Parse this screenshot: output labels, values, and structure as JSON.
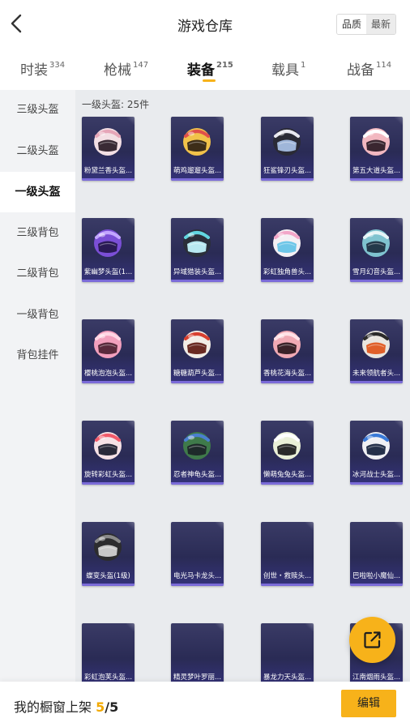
{
  "header": {
    "title": "游戏仓库",
    "sort_options": [
      "品质",
      "最新"
    ],
    "sort_active": "最新"
  },
  "tabs": [
    {
      "label": "时装",
      "count": "334"
    },
    {
      "label": "枪械",
      "count": "147"
    },
    {
      "label": "装备",
      "count": "215",
      "active": true
    },
    {
      "label": "载具",
      "count": "1"
    },
    {
      "label": "战备",
      "count": "114"
    }
  ],
  "sidebar": {
    "items": [
      "三级头盔",
      "二级头盔",
      "一级头盔",
      "三级背包",
      "二级背包",
      "一级背包",
      "背包挂件"
    ],
    "active": "一级头盔"
  },
  "content": {
    "count_label": "一级头盔: 25件",
    "items": [
      {
        "name": "粉黛兰香头盔...",
        "shell": "#f3dfe4",
        "accent": "#e6a6b8",
        "visor": "#3a2a35"
      },
      {
        "name": "萌鸡遛遛头盔...",
        "shell": "#f1c24a",
        "accent": "#e0504a",
        "visor": "#3d2d18"
      },
      {
        "name": "狂鲨锋刃头盔...",
        "shell": "#2a2a35",
        "accent": "#e8e8f0",
        "visor": "#9fb6d9"
      },
      {
        "name": "第五大道头盔...",
        "shell": "#f2b8c0",
        "accent": "#ffffff",
        "visor": "#3a2630"
      },
      {
        "name": "紫幽梦头盔(1...",
        "shell": "#7b4fd6",
        "accent": "#c3a6ff",
        "visor": "#2a1a55"
      },
      {
        "name": "异域猎装头盔...",
        "shell": "#2b2f3a",
        "accent": "#62d6e0",
        "visor": "#b8e8f0"
      },
      {
        "name": "彩虹独角兽头...",
        "shell": "#f4f0f4",
        "accent": "#f2a6c8",
        "visor": "#6ec6e8"
      },
      {
        "name": "雪月幻音头盔...",
        "shell": "#7fc3cf",
        "accent": "#e6f4f6",
        "visor": "#24394a"
      },
      {
        "name": "樱桃泡泡头盔...",
        "shell": "#f2a0bd",
        "accent": "#ffd6e4",
        "visor": "#5a2a3c"
      },
      {
        "name": "糖糖葫芦头盔...",
        "shell": "#f2ede6",
        "accent": "#d8402f",
        "visor": "#6a2a22"
      },
      {
        "name": "香桃花海头盔...",
        "shell": "#f0aab4",
        "accent": "#ffe2e6",
        "visor": "#3a2228"
      },
      {
        "name": "未来领航者头...",
        "shell": "#e9e6e0",
        "accent": "#2a2a2a",
        "visor": "#e0602a"
      },
      {
        "name": "旋转彩虹头盔...",
        "shell": "#f6e2e6",
        "accent": "#f25a6a",
        "visor": "#2a2a3a"
      },
      {
        "name": "忍者神龟头盔...",
        "shell": "#3f7a4a",
        "accent": "#4a7fd0",
        "visor": "#1e2a2a"
      },
      {
        "name": "懒萌兔兔头盔...",
        "shell": "#eaf0d8",
        "accent": "#ffffff",
        "visor": "#2a2a2a"
      },
      {
        "name": "冰河战士头盔...",
        "shell": "#f0f0f4",
        "accent": "#3a7ad8",
        "visor": "#25304a"
      },
      {
        "name": "蝶变头盔(1级)",
        "shell": "#2c2c2e",
        "accent": "#8a8a8a",
        "visor": "#c8c8c8"
      },
      {
        "name": "电光马卡龙头...",
        "shell": null
      },
      {
        "name": "创世・救赎头...",
        "shell": null
      },
      {
        "name": "巴啦啦小魔仙...",
        "shell": null
      },
      {
        "name": "彩虹泡芙头盔...",
        "shell": null
      },
      {
        "name": "精灵梦叶罗丽...",
        "shell": null
      },
      {
        "name": "暴龙力天头盔...",
        "shell": null
      },
      {
        "name": "江南烟雨头盔...",
        "shell": null
      }
    ]
  },
  "footer": {
    "label": "我的橱窗上架",
    "current": "5",
    "separator": "/",
    "total": "5",
    "edit_label": "编辑"
  },
  "colors": {
    "accent": "#f7b21a",
    "card_bg": "#2a2b55",
    "card_bar": "#7b6bd8"
  },
  "icons": {
    "back": "chevron-left-icon",
    "share": "external-link-icon"
  }
}
